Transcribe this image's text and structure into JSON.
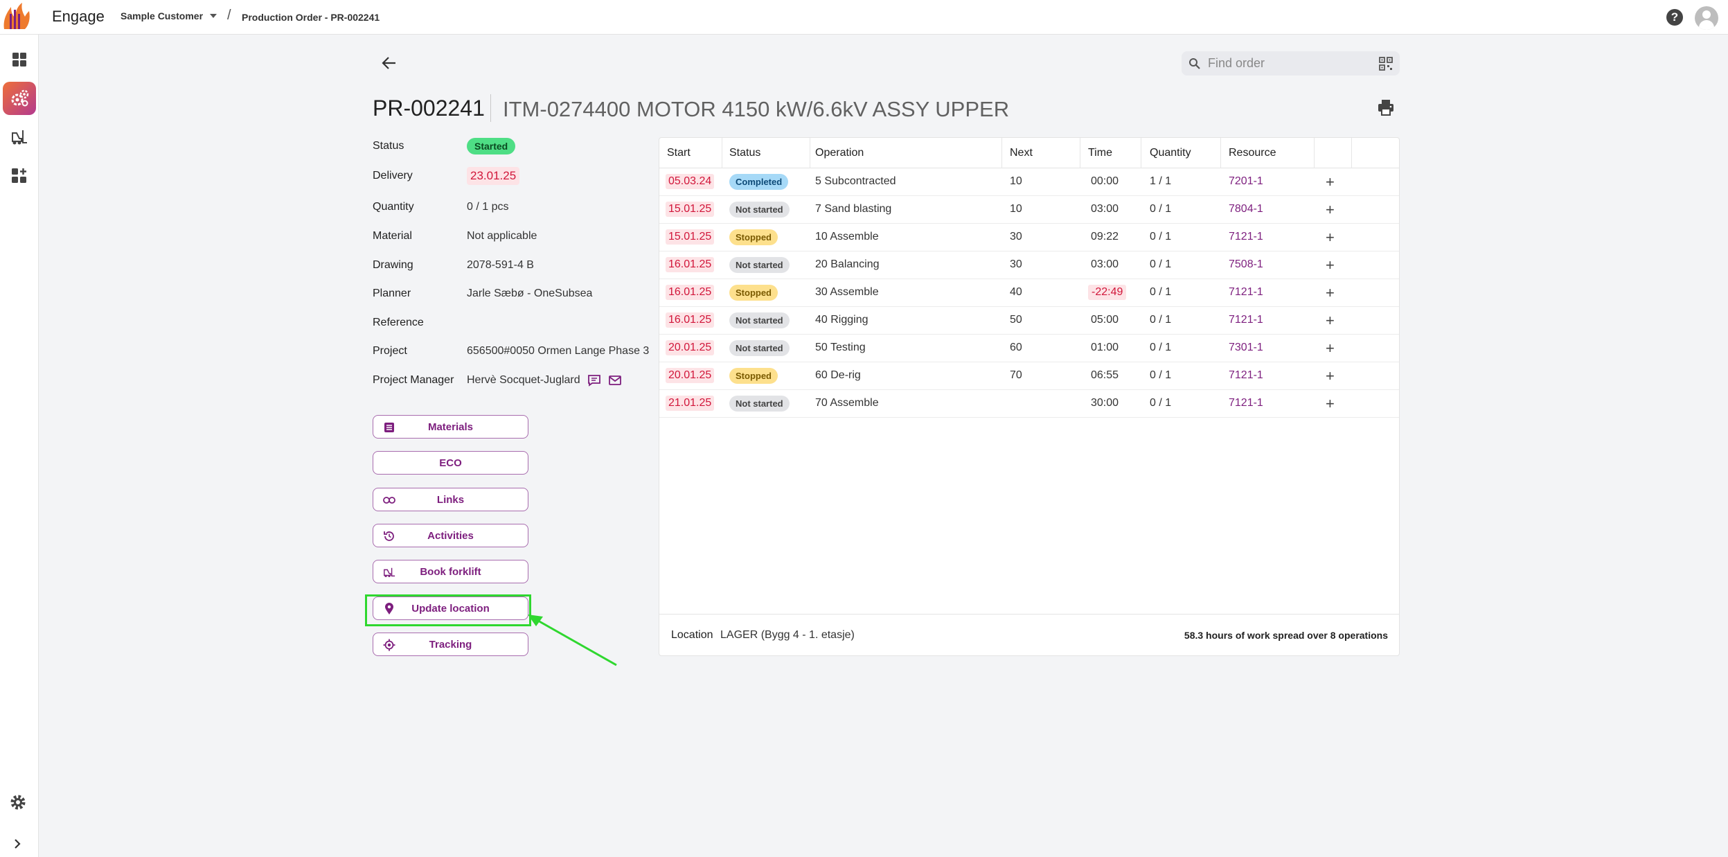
{
  "app": {
    "title": "Engage"
  },
  "header": {
    "customer": "Sample Customer",
    "breadcrumb_sep": "/",
    "breadcrumb": "Production Order - PR-002241",
    "help": "?"
  },
  "search": {
    "placeholder": "Find order"
  },
  "order": {
    "id": "PR-002241",
    "description": "ITM-0274400 MOTOR 4150 kW/6.6kV ASSY UPPER"
  },
  "info": {
    "status_label": "Status",
    "status_value": "Started",
    "delivery_label": "Delivery",
    "delivery_value": "23.01.25",
    "quantity_label": "Quantity",
    "quantity_value": "0 / 1 pcs",
    "material_label": "Material",
    "material_value": "Not applicable",
    "drawing_label": "Drawing",
    "drawing_value": "2078-591-4 B",
    "planner_label": "Planner",
    "planner_value": "Jarle Sæbø - OneSubsea",
    "reference_label": "Reference",
    "reference_value": "",
    "project_label": "Project",
    "project_value": "656500#0050 Ormen Lange Phase 3",
    "pm_label": "Project Manager",
    "pm_value": "Hervè Socquet-Juglard"
  },
  "actions": {
    "materials": "Materials",
    "eco": "ECO",
    "links": "Links",
    "activities": "Activities",
    "book_forklift": "Book forklift",
    "update_location": "Update location",
    "tracking": "Tracking"
  },
  "table": {
    "headers": {
      "start": "Start",
      "status": "Status",
      "operation": "Operation",
      "next": "Next",
      "time": "Time",
      "quantity": "Quantity",
      "resource": "Resource"
    },
    "rows": [
      {
        "start": "05.03.24",
        "status": "Completed",
        "operation": "5 Subcontracted",
        "next": "10",
        "time": "00:00",
        "quantity": "1 / 1",
        "resource": "7201-1"
      },
      {
        "start": "15.01.25",
        "status": "Not started",
        "operation": "7 Sand blasting",
        "next": "10",
        "time": "03:00",
        "quantity": "0 / 1",
        "resource": "7804-1"
      },
      {
        "start": "15.01.25",
        "status": "Stopped",
        "operation": "10 Assemble",
        "next": "30",
        "time": "09:22",
        "quantity": "0 / 1",
        "resource": "7121-1"
      },
      {
        "start": "16.01.25",
        "status": "Not started",
        "operation": "20 Balancing",
        "next": "30",
        "time": "03:00",
        "quantity": "0 / 1",
        "resource": "7508-1"
      },
      {
        "start": "16.01.25",
        "status": "Stopped",
        "operation": "30 Assemble",
        "next": "40",
        "time": "-22:49",
        "quantity": "0 / 1",
        "resource": "7121-1"
      },
      {
        "start": "16.01.25",
        "status": "Not started",
        "operation": "40 Rigging",
        "next": "50",
        "time": "05:00",
        "quantity": "0 / 1",
        "resource": "7121-1"
      },
      {
        "start": "20.01.25",
        "status": "Not started",
        "operation": "50 Testing",
        "next": "60",
        "time": "01:00",
        "quantity": "0 / 1",
        "resource": "7301-1"
      },
      {
        "start": "20.01.25",
        "status": "Stopped",
        "operation": "60 De-rig",
        "next": "70",
        "time": "06:55",
        "quantity": "0 / 1",
        "resource": "7121-1"
      },
      {
        "start": "21.01.25",
        "status": "Not started",
        "operation": "70 Assemble",
        "next": "",
        "time": "30:00",
        "quantity": "0 / 1",
        "resource": "7121-1"
      }
    ],
    "plus": "+"
  },
  "footer": {
    "location_label": "Location",
    "location_value": "LAGER  (Bygg 4 - 1. etasje)",
    "work_summary": "58.3 hours of work spread over 8 operations"
  },
  "colors": {
    "accent": "#7d1e7e",
    "started": "#4ede85",
    "completed": "#a6d9f7",
    "stopped": "#fde08d",
    "not_started": "#e2e3e6",
    "overdue": "#d1163a",
    "highlight": "#2fd72f"
  },
  "icons": {
    "sidebar": [
      "dashboard-icon",
      "production-icon",
      "forklift-icon",
      "add-widget-icon"
    ],
    "bottom": [
      "settings-icon",
      "expand-icon"
    ]
  }
}
